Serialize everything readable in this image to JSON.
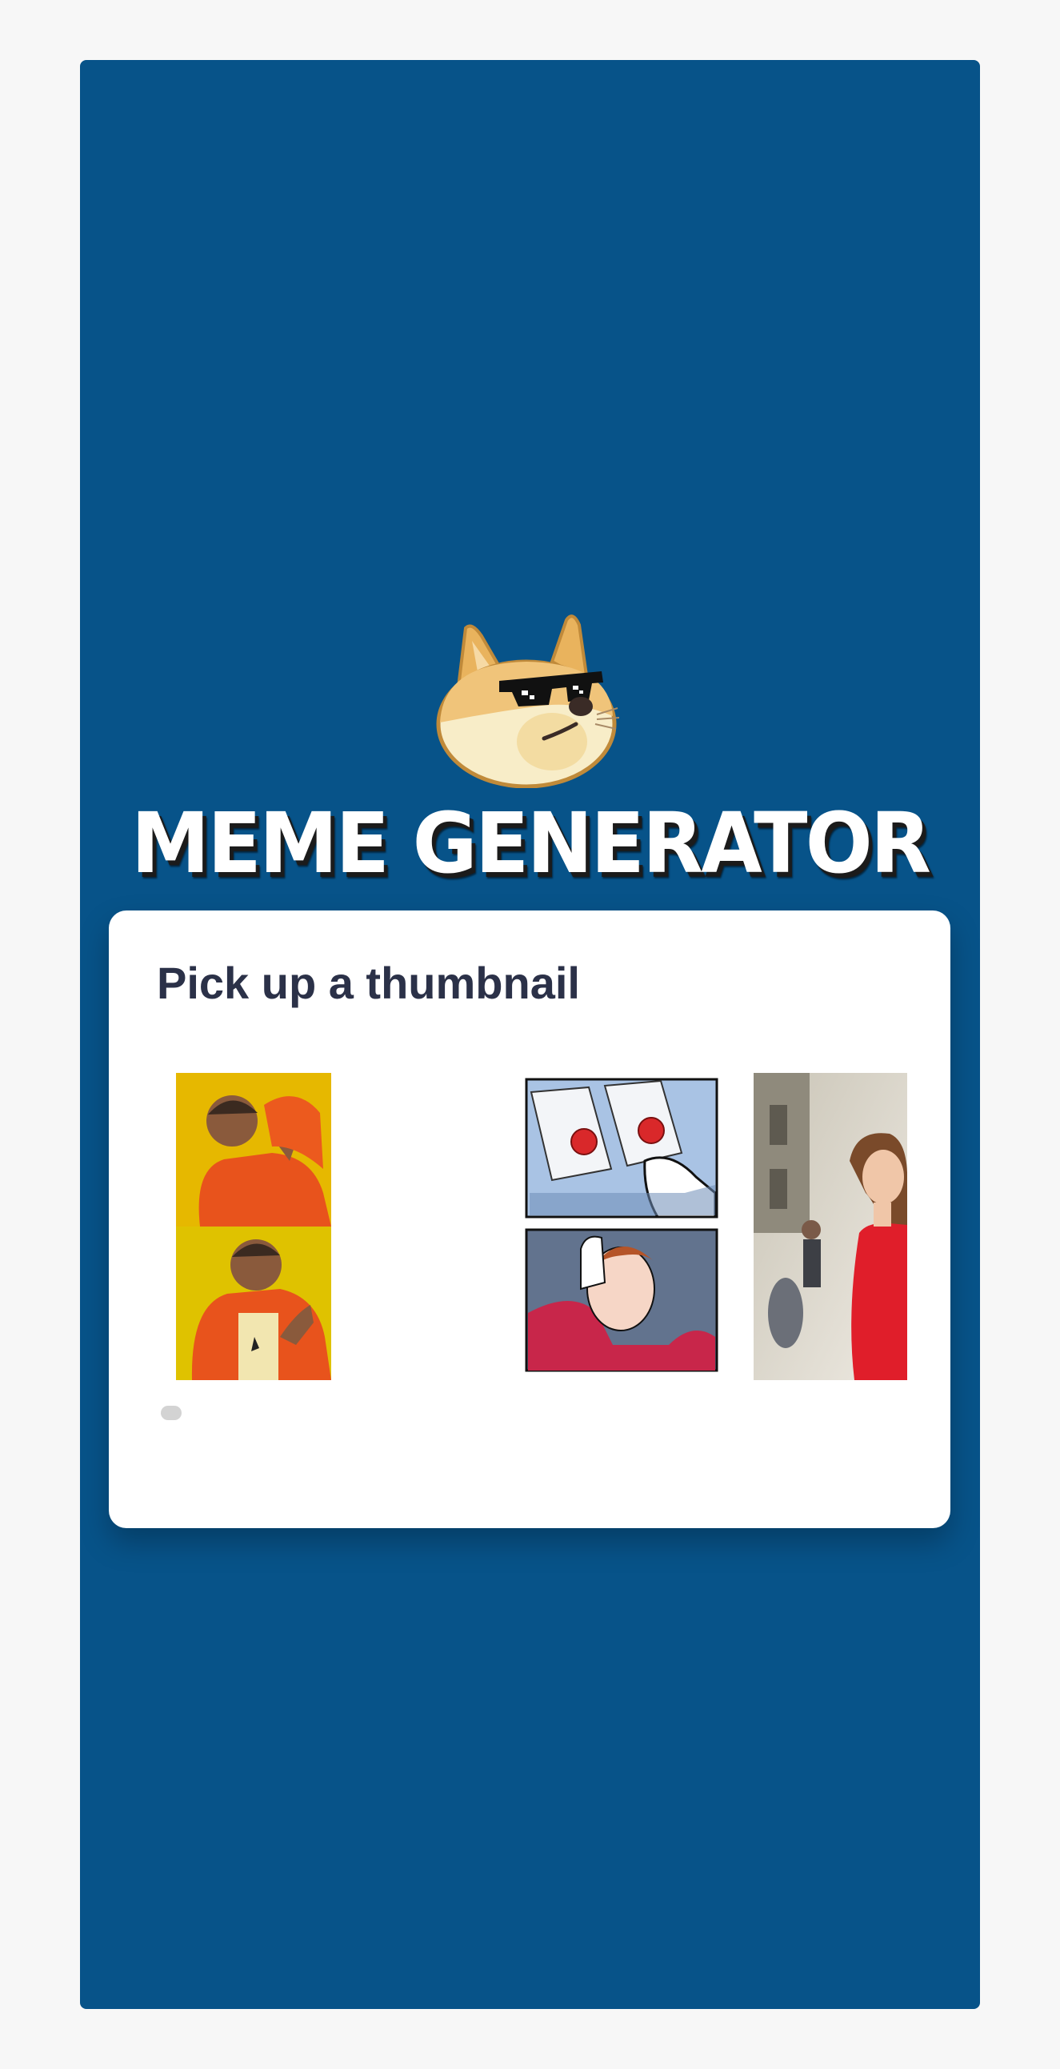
{
  "app": {
    "title": "MEME GENERATOR",
    "logo_icon": "doge-sunglasses-icon",
    "colors": {
      "background": "#075389",
      "card": "#ffffff",
      "heading": "#2b3148"
    }
  },
  "picker": {
    "title": "Pick up a thumbnail",
    "thumbnails": [
      {
        "name": "drake-hotline-bling"
      },
      {
        "name": "two-buttons"
      },
      {
        "name": "distracted-boyfriend"
      }
    ]
  }
}
